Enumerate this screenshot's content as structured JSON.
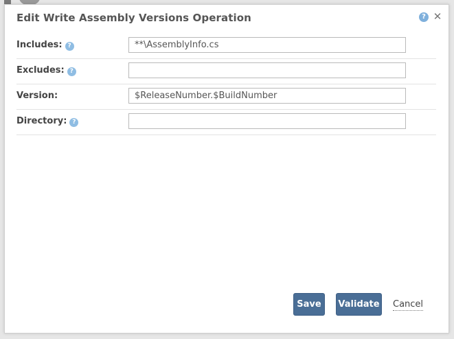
{
  "dialog": {
    "title": "Edit Write Assembly Versions Operation",
    "help_glyph": "?",
    "close_glyph": "✕"
  },
  "form": {
    "fields": [
      {
        "label": "Includes:",
        "has_help": true,
        "value": "**\\AssemblyInfo.cs"
      },
      {
        "label": "Excludes:",
        "has_help": true,
        "value": ""
      },
      {
        "label": "Version:",
        "has_help": false,
        "value": "$ReleaseNumber.$BuildNumber"
      },
      {
        "label": "Directory:",
        "has_help": true,
        "value": ""
      }
    ],
    "help_glyph": "?"
  },
  "actions": {
    "save_label": "Save",
    "validate_label": "Validate",
    "cancel_label": "Cancel"
  },
  "colors": {
    "primary_button": "#4a6e96",
    "help_icon": "#8fbde3"
  }
}
